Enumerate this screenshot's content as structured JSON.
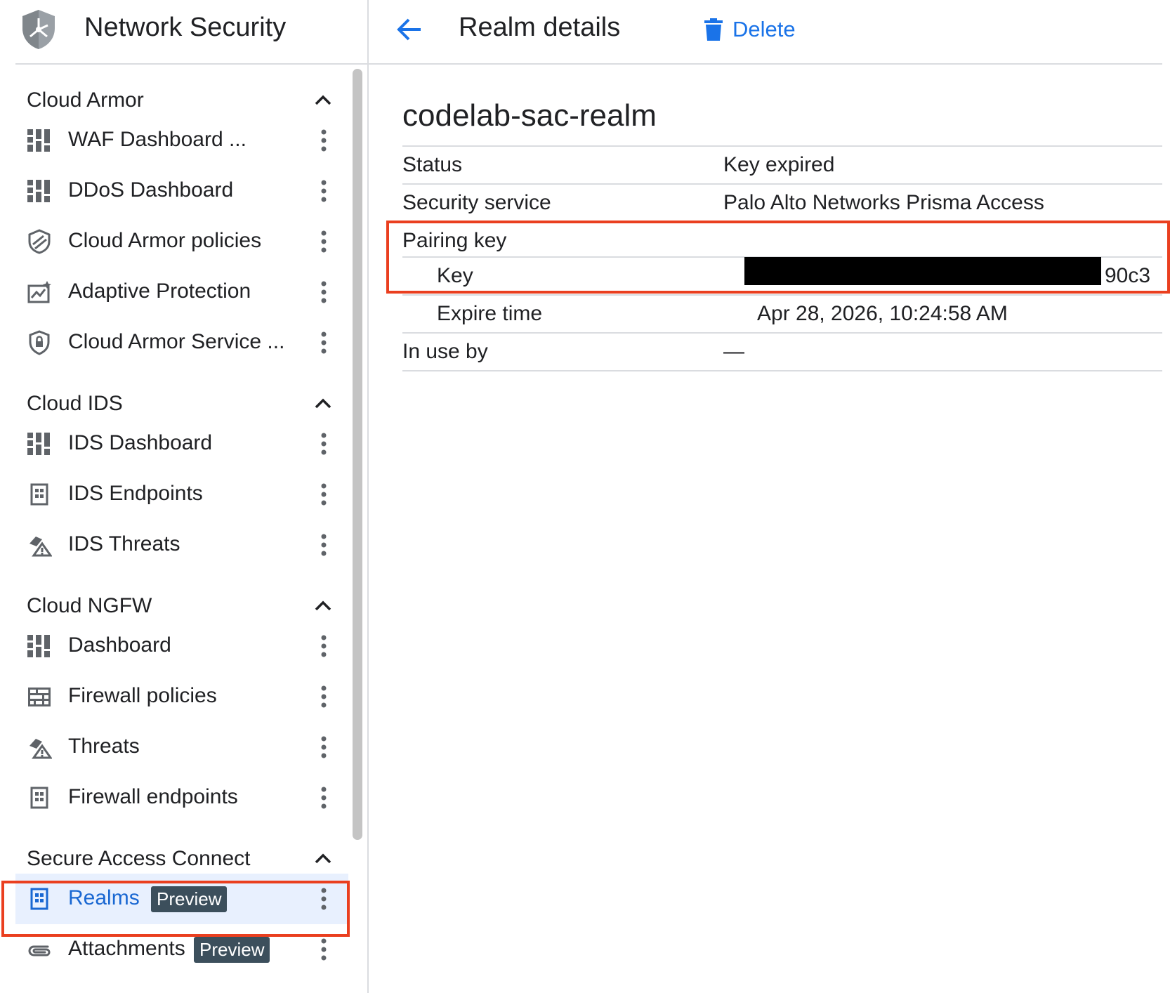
{
  "app": {
    "title": "Network Security"
  },
  "page": {
    "title": "Realm details",
    "delete_label": "Delete",
    "resource_name": "codelab-sac-realm"
  },
  "colors": {
    "accent": "#1a73e8",
    "highlight": "#ea3f1f",
    "active_bg": "#e8f0fe",
    "badge_bg": "#3c4f5c"
  },
  "sidebar": {
    "sections": [
      {
        "title": "Cloud Armor",
        "items": [
          {
            "label": "WAF Dashboard ...",
            "icon": "dashboard-icon"
          },
          {
            "label": "DDoS Dashboard",
            "icon": "dashboard-icon"
          },
          {
            "label": "Cloud Armor policies",
            "icon": "shield-stripes-icon"
          },
          {
            "label": "Adaptive Protection",
            "icon": "chart-sparkle-icon"
          },
          {
            "label": "Cloud Armor Service ...",
            "icon": "shield-lock-icon"
          }
        ]
      },
      {
        "title": "Cloud IDS",
        "items": [
          {
            "label": "IDS Dashboard",
            "icon": "dashboard-icon"
          },
          {
            "label": "IDS Endpoints",
            "icon": "endpoint-icon"
          },
          {
            "label": "IDS Threats",
            "icon": "threat-icon"
          }
        ]
      },
      {
        "title": "Cloud NGFW",
        "items": [
          {
            "label": "Dashboard",
            "icon": "dashboard-icon"
          },
          {
            "label": "Firewall policies",
            "icon": "firewall-icon"
          },
          {
            "label": "Threats",
            "icon": "threat-icon"
          },
          {
            "label": "Firewall endpoints",
            "icon": "endpoint-icon"
          }
        ]
      },
      {
        "title": "Secure Access Connect",
        "items": [
          {
            "label": "Realms",
            "icon": "endpoint-icon",
            "badge": "Preview",
            "active": true
          },
          {
            "label": "Attachments",
            "icon": "paperclip-icon",
            "badge": "Preview"
          }
        ]
      }
    ]
  },
  "details": {
    "status_label": "Status",
    "status_value": "Key expired",
    "service_label": "Security service",
    "service_value": "Palo Alto Networks Prisma Access",
    "pairing_label": "Pairing key",
    "key_label": "Key",
    "key_suffix": "90c3",
    "expire_label": "Expire time",
    "expire_value": "Apr 28, 2026, 10:24:58 AM",
    "in_use_label": "In use by",
    "in_use_value": "—"
  }
}
